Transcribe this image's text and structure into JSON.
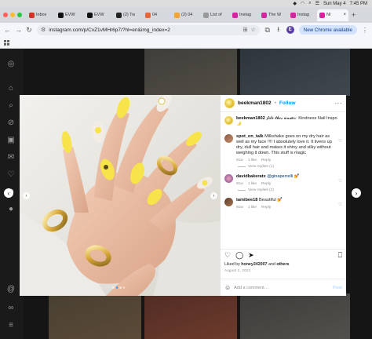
{
  "menubar": {
    "date": "Sun May 4",
    "time": "7:45 PM"
  },
  "tabs": [
    {
      "title": "Inbox",
      "color": "#d93025"
    },
    {
      "title": "EVW",
      "color": "#111111"
    },
    {
      "title": "EVW",
      "color": "#111111"
    },
    {
      "title": "(2) Tw",
      "color": "#222222"
    },
    {
      "title": "04",
      "color": "#e8663d"
    },
    {
      "title": "(2) 04",
      "color": "#f2a33a"
    },
    {
      "title": "List of",
      "color": "#999999"
    },
    {
      "title": "Instag",
      "color": "#d6249f"
    },
    {
      "title": "The W",
      "color": "#d6249f"
    },
    {
      "title": "Instag",
      "color": "#d6249f"
    },
    {
      "title": "Nl",
      "color": "#d6249f"
    }
  ],
  "address": {
    "url": "instagram.com/p/CvZ1vMHr6p7/?hl=en&img_index=2",
    "profile_initial": "E",
    "new_chrome_label": "New Chrome available"
  },
  "post": {
    "username": "beekman1802",
    "follow_label": "Follow",
    "caption_user": "beekman1802",
    "caption_text": "𝓯𝓲𝓵𝓮 𝓽𝓱𝓲𝓼 𝓾𝓷𝓭𝓮𝓻: Kindness Nail Inspo 🌛",
    "comments": [
      {
        "user": "spot_on_talk",
        "text": "Milkshake goes on my dry hair as well as my face !!!! I absolutely love it. It livens up dry, dull hair and makes it shiny and silky without weighing it down. This stuff is magic",
        "time": "91w",
        "likes": "1 like",
        "reply": "Reply",
        "view_replies": "View replies (1)"
      },
      {
        "user": "davidbakeratx",
        "mention": "@ginaperrelli 💅",
        "time": "91w",
        "likes": "1 like",
        "reply": "Reply",
        "view_replies": "View replies (2)"
      },
      {
        "user": "tamibee18",
        "text": "Beautiful 💅",
        "time": "91w",
        "likes": "1 like",
        "reply": "Reply"
      }
    ],
    "likes_prefix": "Liked by",
    "likes_user": "honey242007",
    "likes_and": "and",
    "likes_others": "others",
    "date": "August 1, 2023",
    "add_comment_placeholder": "Add a comment…",
    "post_label": "Post"
  },
  "colors": {
    "instagram_blue": "#0095f6",
    "page_background": "#151515"
  }
}
